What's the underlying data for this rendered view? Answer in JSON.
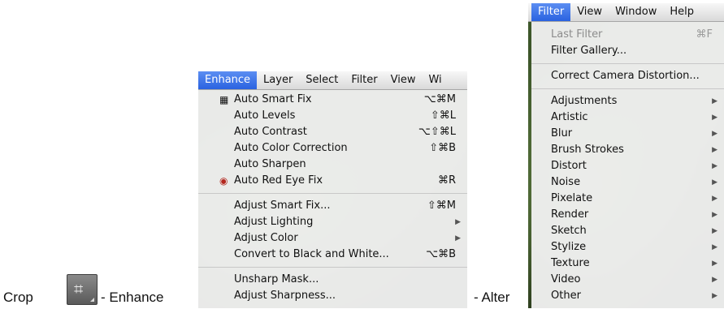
{
  "captions": {
    "crop": "Crop",
    "enhance": "- Enhance",
    "alter": "- Alter"
  },
  "crop_icon": {
    "glyph": "⌗"
  },
  "enhance_menu": {
    "menubar": [
      "Enhance",
      "Layer",
      "Select",
      "Filter",
      "View",
      "Wi"
    ],
    "groups": [
      [
        {
          "label": "Auto Smart Fix",
          "shortcut": "⌥⌘M",
          "icon": "smart-fix"
        },
        {
          "label": "Auto Levels",
          "shortcut": "⇧⌘L"
        },
        {
          "label": "Auto Contrast",
          "shortcut": "⌥⇧⌘L"
        },
        {
          "label": "Auto Color Correction",
          "shortcut": "⇧⌘B"
        },
        {
          "label": "Auto Sharpen",
          "shortcut": ""
        },
        {
          "label": "Auto Red Eye Fix",
          "shortcut": "⌘R",
          "icon": "red-eye"
        }
      ],
      [
        {
          "label": "Adjust Smart Fix...",
          "shortcut": "⇧⌘M"
        },
        {
          "label": "Adjust Lighting",
          "submenu": true
        },
        {
          "label": "Adjust Color",
          "submenu": true
        },
        {
          "label": "Convert to Black and White...",
          "shortcut": "⌥⌘B"
        }
      ],
      [
        {
          "label": "Unsharp Mask...",
          "shortcut": ""
        },
        {
          "label": "Adjust Sharpness...",
          "shortcut": ""
        }
      ]
    ]
  },
  "filter_menu": {
    "menubar": [
      "Filter",
      "View",
      "Window",
      "Help"
    ],
    "top": [
      {
        "label": "Last Filter",
        "shortcut": "⌘F",
        "disabled": true
      },
      {
        "label": "Filter Gallery..."
      }
    ],
    "middle": [
      {
        "label": "Correct Camera Distortion..."
      }
    ],
    "submenus": [
      "Adjustments",
      "Artistic",
      "Blur",
      "Brush Strokes",
      "Distort",
      "Noise",
      "Pixelate",
      "Render",
      "Sketch",
      "Stylize",
      "Texture",
      "Video",
      "Other"
    ]
  }
}
